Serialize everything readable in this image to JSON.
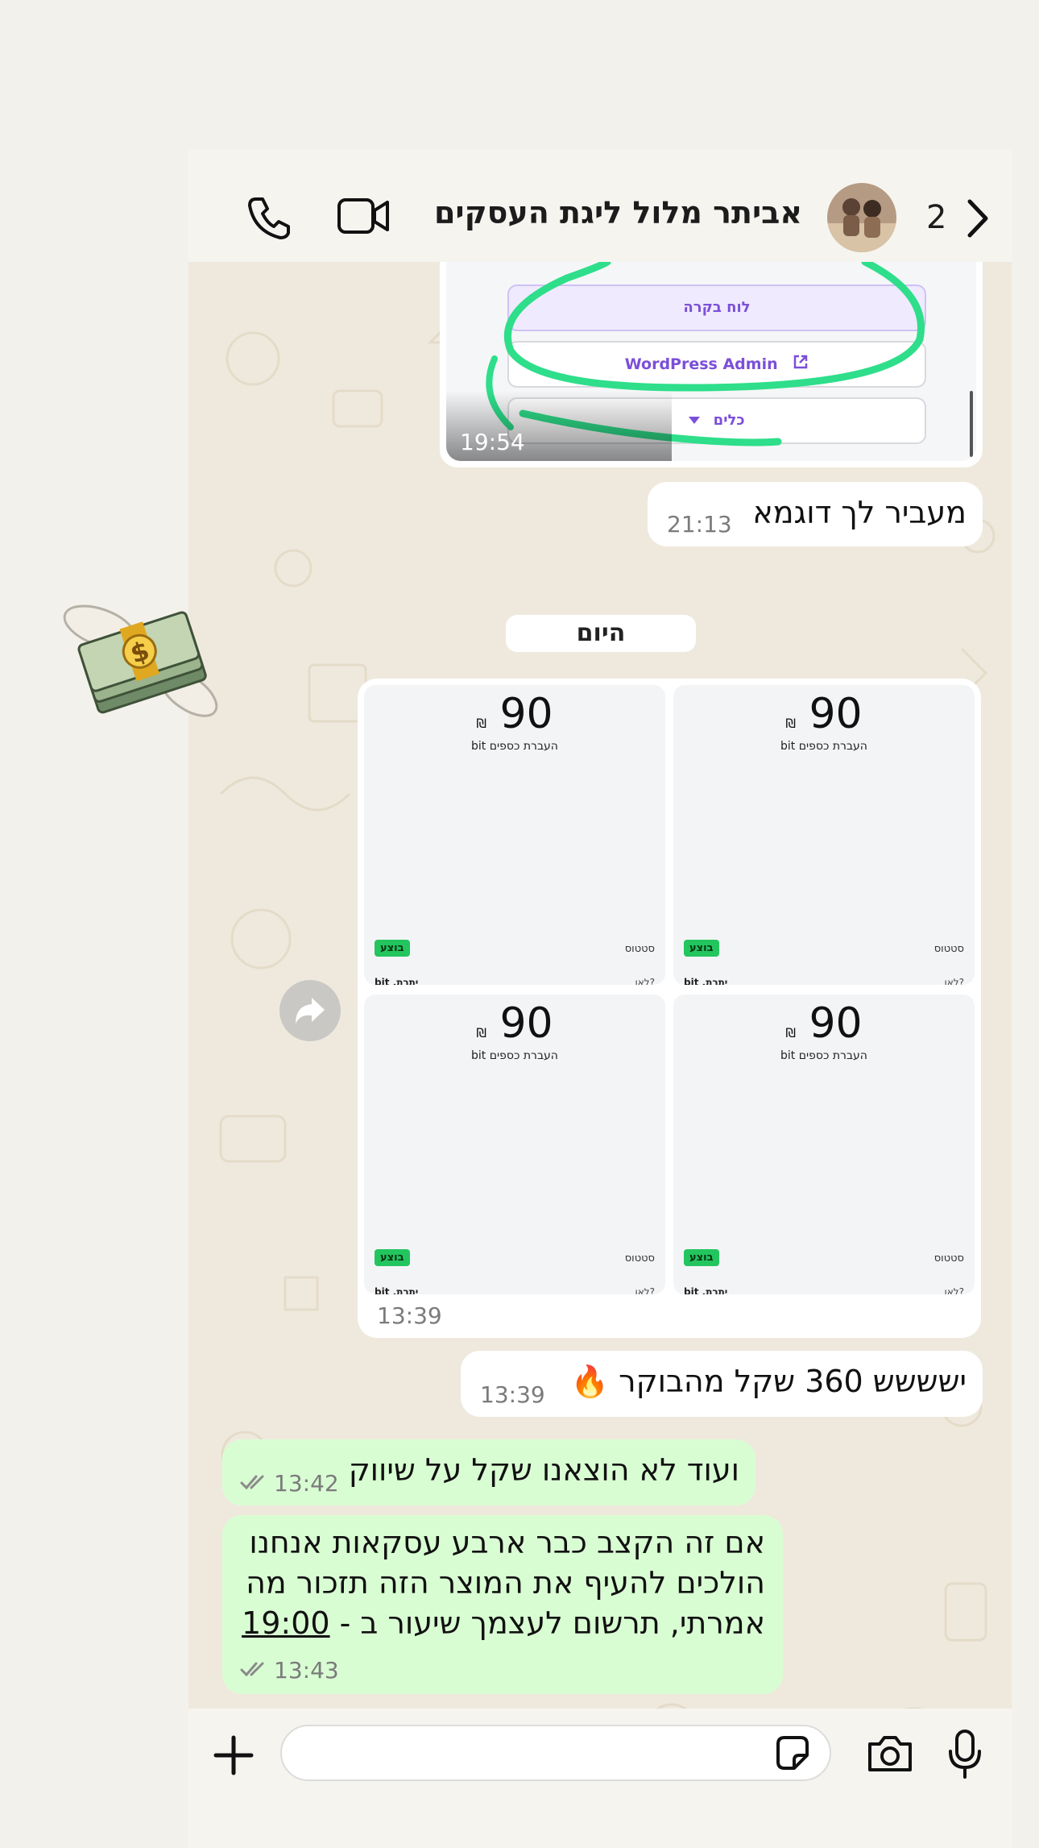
{
  "header": {
    "unread_count": "2",
    "contact_name": "אביתר מלול ליגת העסקים",
    "icons": [
      "chevron-back-icon",
      "video-call-icon",
      "voice-call-icon"
    ]
  },
  "image_message": {
    "buttons": [
      "לוח בקרה",
      "WordPress Admin",
      "כלים"
    ],
    "time": "19:54"
  },
  "messages": [
    {
      "text": "מעביר לך דוגמא",
      "time": "21:13",
      "direction": "incoming"
    }
  ],
  "sticker": {
    "name": "money-with-wings"
  },
  "date_divider": "היום",
  "payment_grid": {
    "time": "13:39",
    "tiles": [
      {
        "amount": "90",
        "currency": "₪",
        "subtitle": "העברת כספים bit",
        "status_label": "סטטוס",
        "status_badge": "בוצע",
        "footer_left": "bit ,יתרת",
        "footer_right": "לאן?"
      },
      {
        "amount": "90",
        "currency": "₪",
        "subtitle": "העברת כספים bit",
        "status_label": "סטטוס",
        "status_badge": "בוצע",
        "footer_left": "bit ,יתרת",
        "footer_right": "לאן?"
      },
      {
        "amount": "90",
        "currency": "₪",
        "subtitle": "העברת כספים bit",
        "status_label": "סטטוס",
        "status_badge": "בוצע",
        "footer_left": "bit ,יתרת",
        "footer_right": "לאן?"
      },
      {
        "amount": "90",
        "currency": "₪",
        "subtitle": "העברת כספים bit",
        "status_label": "סטטוס",
        "status_badge": "בוצע",
        "footer_left": "bit ,יתרת",
        "footer_right": "לאן?"
      }
    ]
  },
  "incoming_2": {
    "text": "ישששש 360 שקל מהבוקר 🔥",
    "time": "13:39"
  },
  "outgoing_1": {
    "text": "ועוד לא הוצאנו שקל על שיווק",
    "time": "13:42"
  },
  "outgoing_2": {
    "lines": [
      "אם זה הקצב כבר ארבע עסקאות אנחנו",
      "הולכים להעיף את המוצר הזה תזכור מה",
      "אמרתי, תרשום לעצמך שיעור ב - "
    ],
    "time_link": "19:00",
    "time": "13:43"
  },
  "composer": {
    "placeholder": ""
  },
  "colors": {
    "incoming_bubble": "#ffffff",
    "outgoing_bubble": "#d9fdd3",
    "accent_green": "#22c55e",
    "chat_bg": "#efe9dd"
  }
}
